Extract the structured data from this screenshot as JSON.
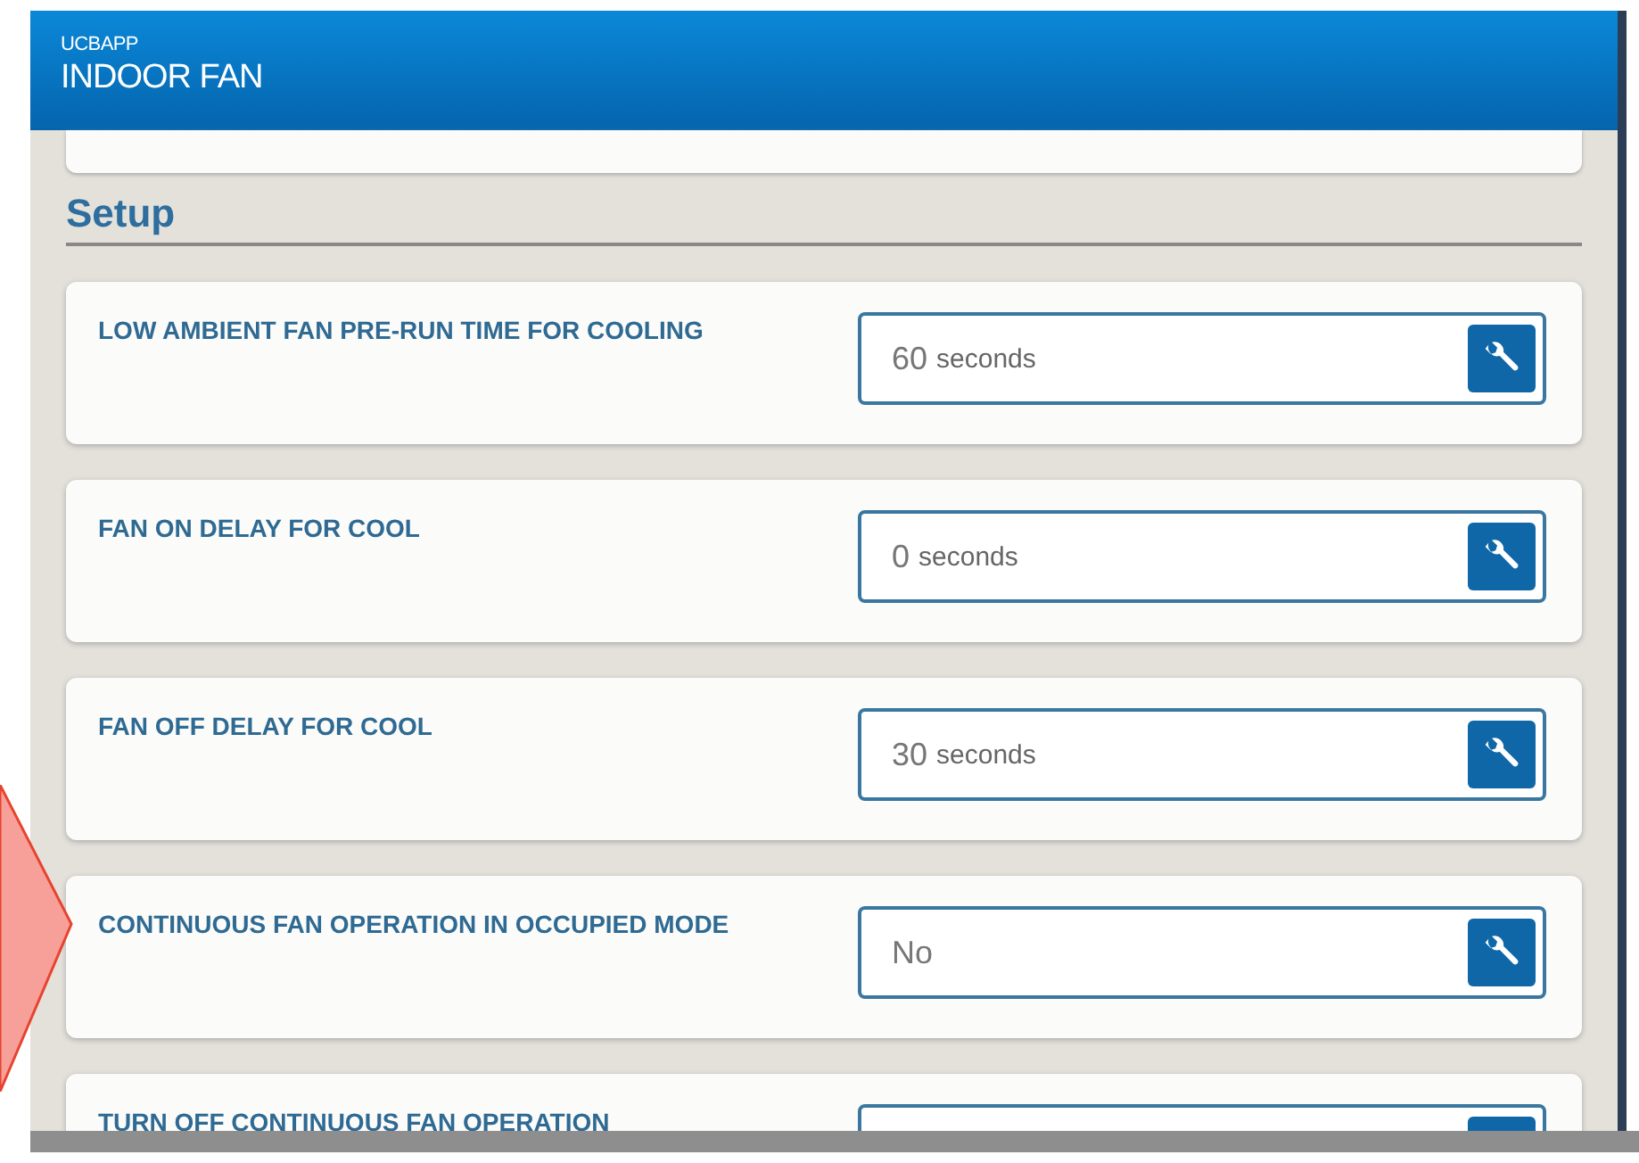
{
  "header": {
    "app": "UCBAPP",
    "title": "INDOOR FAN"
  },
  "section": {
    "title": "Setup"
  },
  "settings": [
    {
      "label": "LOW AMBIENT FAN PRE-RUN TIME FOR COOLING",
      "value": "60",
      "unit": "seconds"
    },
    {
      "label": "FAN ON DELAY FOR COOL",
      "value": "0",
      "unit": "seconds"
    },
    {
      "label": "FAN OFF DELAY FOR COOL",
      "value": "30",
      "unit": "seconds"
    },
    {
      "label": "CONTINUOUS FAN OPERATION IN OCCUPIED MODE",
      "value": "No"
    },
    {
      "label": "TURN OFF CONTINUOUS FAN OPERATION"
    }
  ]
}
